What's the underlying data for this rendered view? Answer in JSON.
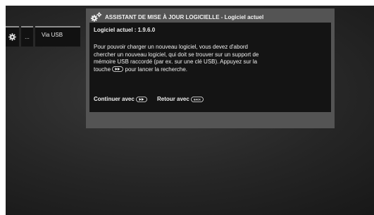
{
  "menu": {
    "gear_icon": "gear-icon",
    "dots_label": "...",
    "usb_label": "Via USB"
  },
  "dialog": {
    "title_icon": "gears-icon",
    "title": "ASSISTANT DE MISE À JOUR LOGICIELLE - Logiciel actuel",
    "version": "Logiciel actuel : 1.9.6.0",
    "paragraph_before_key": "Pour pouvoir charger un nouveau logiciel, vous devez d'abord chercher un nouveau logiciel, qui doit se trouver sur un support de mémoire USB raccordé (par ex. sur une clé USB). Appuyez sur la touche",
    "paragraph_key_icon": "fast-forward-key-icon",
    "paragraph_after_key": "pour lancer la recherche.",
    "continue_label": "Continuer avec",
    "continue_key_icon": "fast-forward-key-icon",
    "back_label": "Retour avec",
    "back_key_icon": "back-key-icon",
    "back_key_text": "BACK"
  }
}
